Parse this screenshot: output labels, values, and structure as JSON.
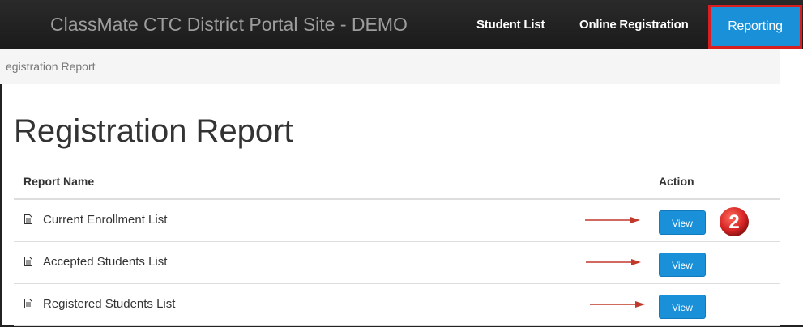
{
  "navbar": {
    "brand": "ClassMate CTC District Portal Site - DEMO",
    "links": [
      "Student List",
      "Online Registration",
      "Reporting"
    ],
    "active_link": "Reporting",
    "active_color": "#1a90d8",
    "highlight_color": "#d81e1e"
  },
  "breadcrumb": {
    "current": "egistration Report"
  },
  "page": {
    "title": "Registration Report"
  },
  "table": {
    "columns": [
      "Report Name",
      "Action"
    ],
    "rows": [
      {
        "name": "Current Enrollment List",
        "action": "View",
        "icon": "document-icon"
      },
      {
        "name": "Accepted Students List",
        "action": "View",
        "icon": "document-icon"
      },
      {
        "name": "Registered Students List",
        "action": "View",
        "icon": "document-icon"
      }
    ]
  },
  "annotations": {
    "step_badge": "2",
    "badge_color": "#d42323",
    "arrow_color": "#c0392b"
  }
}
